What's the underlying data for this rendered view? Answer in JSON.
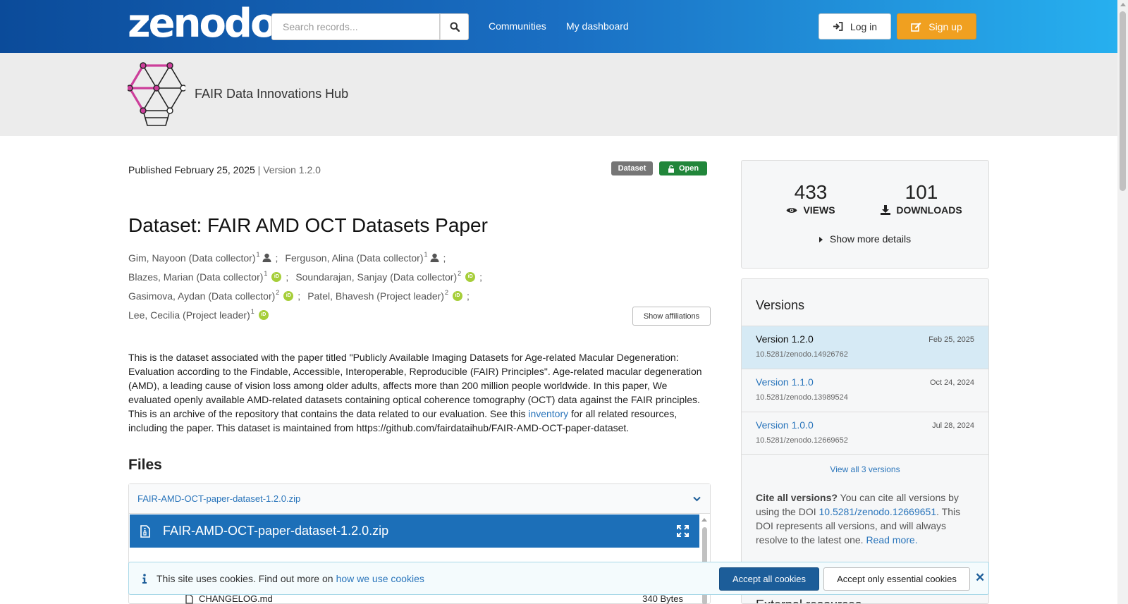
{
  "header": {
    "logo": "zenodo",
    "search_placeholder": "Search records...",
    "nav": [
      "Communities",
      "My dashboard"
    ],
    "login_label": "Log in",
    "signup_label": "Sign up",
    "signup_color": "#f0a020"
  },
  "community": {
    "name": "FAIR Data Innovations Hub"
  },
  "record": {
    "published": "Published February 25, 2025",
    "version_sep": " | ",
    "version": "Version 1.2.0",
    "badges": {
      "type": "Dataset",
      "access": "Open"
    },
    "title": "Dataset: FAIR AMD OCT Datasets Paper",
    "creators": [
      {
        "name": "Gim, Nayoon (Data collector)",
        "aff": "1",
        "id": "person"
      },
      {
        "name": "Ferguson, Alina (Data collector)",
        "aff": "1",
        "id": "person"
      },
      {
        "name": "Blazes, Marian (Data collector)",
        "aff": "1",
        "id": "orcid"
      },
      {
        "name": "Soundarajan, Sanjay (Data collector)",
        "aff": "2",
        "id": "orcid"
      },
      {
        "name": "Gasimova, Aydan (Data collector)",
        "aff": "2",
        "id": "orcid"
      },
      {
        "name": "Patel, Bhavesh (Project leader)",
        "aff": "2",
        "id": "orcid"
      },
      {
        "name": "Lee, Cecilia (Project leader)",
        "aff": "1",
        "id": "orcid"
      }
    ],
    "show_affiliations": "Show affiliations",
    "description_before": "This is the dataset associated with the paper titled \"Publicly Available Imaging Datasets for Age-related Macular Degeneration: Evaluation according to the Findable, Accessible, Interoperable, Reproducible (FAIR) Principles\". Age-related macular degeneration (AMD), a leading cause of vision loss among older adults, affects more than 200 million people worldwide. In this paper, We evaluated openly available AMD-related datasets containing optical coherence tomography (OCT) data against the FAIR principles. This is an archive of the repository that contains the data related to our evaluation. See this ",
    "description_link": "inventory",
    "description_after": " for all related resources, including the paper. This dataset is maintained from https://github.com/fairdataihub/FAIR-AMD-OCT-paper-dataset."
  },
  "files": {
    "heading": "Files",
    "archive_name": "FAIR-AMD-OCT-paper-dataset-1.2.0.zip",
    "preview_title": "FAIR-AMD-OCT-paper-dataset-1.2.0.zip",
    "entries": [
      {
        "name": "CHANGELOG.md",
        "size": "340 Bytes"
      }
    ]
  },
  "stats": {
    "views": "433",
    "views_label": "VIEWS",
    "downloads": "101",
    "downloads_label": "DOWNLOADS",
    "more_details": "Show more details"
  },
  "versions": {
    "title": "Versions",
    "items": [
      {
        "label": "Version 1.2.0",
        "date": "Feb 25, 2025",
        "doi": "10.5281/zenodo.14926762",
        "active": true
      },
      {
        "label": "Version 1.1.0",
        "date": "Oct 24, 2024",
        "doi": "10.5281/zenodo.13989524",
        "active": false
      },
      {
        "label": "Version 1.0.0",
        "date": "Jul 28, 2024",
        "doi": "10.5281/zenodo.12669652",
        "active": false
      }
    ],
    "view_all": "View all 3 versions",
    "cite_all_bold": "Cite all versions?",
    "cite_all_text": " You can cite all versions by using the DOI ",
    "cite_all_doi": "10.5281/zenodo.12669651",
    "cite_all_text2": ". This DOI represents all versions, and will always resolve to the latest one. ",
    "read_more": "Read more."
  },
  "external_resources": "External resources",
  "cookie": {
    "text": "This site uses cookies. Find out more on",
    "link": "how we use cookies",
    "accept_all": "Accept all cookies",
    "accept_essential": "Accept only essential cookies"
  }
}
